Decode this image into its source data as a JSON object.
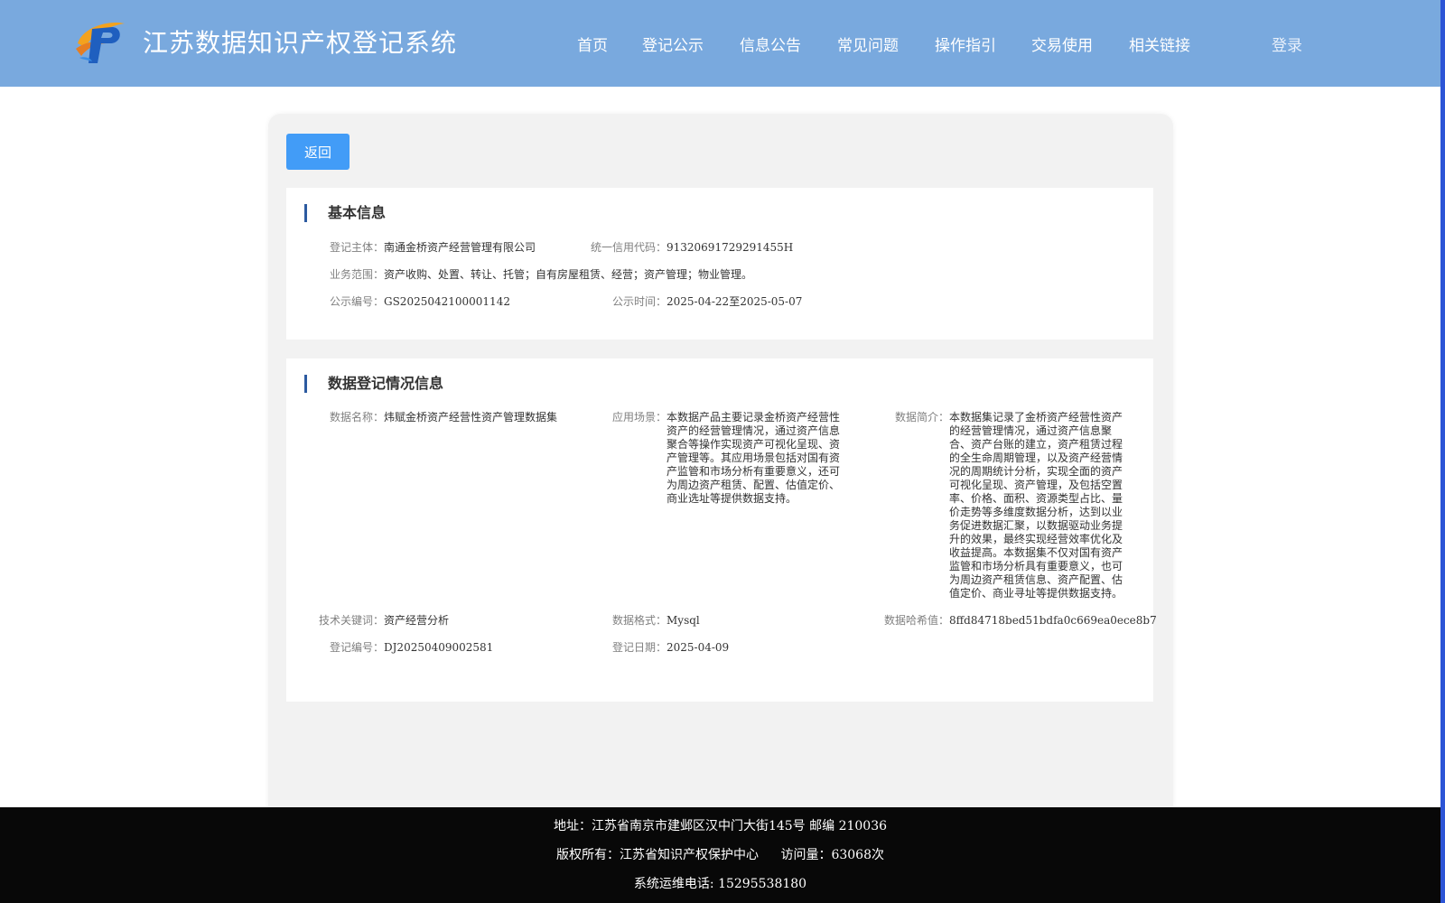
{
  "header": {
    "title": "江苏数据知识产权登记系统",
    "nav": [
      "首页",
      "登记公示",
      "信息公告",
      "常见问题",
      "操作指引",
      "交易使用",
      "相关链接"
    ],
    "login": "登录"
  },
  "back_button": "返回",
  "basic_info": {
    "title": "基本信息",
    "subject_label": "登记主体：",
    "subject_value": "南通金桥资产经营管理有限公司",
    "credit_label": "统一信用代码：",
    "credit_value": "91320691729291455H",
    "scope_label": "业务范围：",
    "scope_value": "资产收购、处置、转让、托管；自有房屋租赁、经营；资产管理；物业管理。",
    "pub_no_label": "公示编号：",
    "pub_no_value": "GS2025042100001142",
    "pub_time_label": "公示时间：",
    "pub_time_value": "2025-04-22至2025-05-07"
  },
  "data_info": {
    "title": "数据登记情况信息",
    "name_label": "数据名称：",
    "name_value": "炜赋金桥资产经营性资产管理数据集",
    "scene_label": "应用场景：",
    "scene_value": "本数据产品主要记录金桥资产经营性资产的经营管理情况，通过资产信息聚合等操作实现资产可视化呈现、资产管理等。其应用场景包括对国有资产监管和市场分析有重要意义，还可为周边资产租赁、配置、估值定价、商业选址等提供数据支持。",
    "intro_label": "数据简介：",
    "intro_value": "本数据集记录了金桥资产经营性资产的经营管理情况，通过资产信息聚合、资产台账的建立，资产租赁过程的全生命周期管理，以及资产经营情况的周期统计分析，实现全面的资产可视化呈现、资产管理，及包括空置率、价格、面积、资源类型占比、量价走势等多维度数据分析，达到以业务促进数据汇聚，以数据驱动业务提升的效果，最终实现经营效率优化及收益提高。本数据集不仅对国有资产监管和市场分析具有重要意义，也可为周边资产租赁信息、资产配置、估值定价、商业寻址等提供数据支持。",
    "keyword_label": "技术关键词：",
    "keyword_value": "资产经营分析",
    "format_label": "数据格式：",
    "format_value": "Mysql",
    "hash_label": "数据哈希值：",
    "hash_value": "8ffd84718bed51bdfa0c669ea0ece8b7",
    "reg_no_label": "登记编号：",
    "reg_no_value": "DJ20250409002581",
    "reg_date_label": "登记日期：",
    "reg_date_value": "2025-04-09"
  },
  "footer": {
    "address": "地址：江苏省南京市建邺区汉中门大街145号 邮编 210036",
    "copyright": "版权所有：江苏省知识产权保护中心",
    "visits": "访问量：63068次",
    "phone": "系统运维电话: 15295538180"
  },
  "colors": {
    "header_bg": "#79a9de",
    "button": "#429cf7",
    "footer_bg": "#080808",
    "section_bar": "#2c5aa0"
  }
}
